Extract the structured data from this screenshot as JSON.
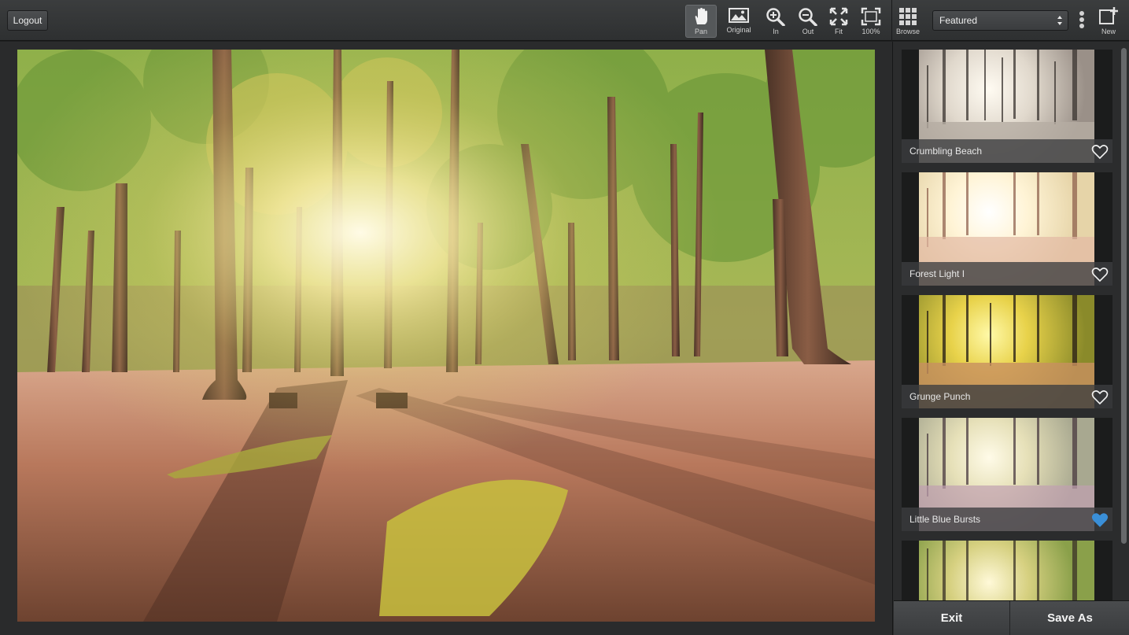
{
  "toolbar": {
    "logout_label": "Logout",
    "tools": [
      {
        "label": "Pan",
        "icon": "hand-icon",
        "active": true
      },
      {
        "label": "Original",
        "icon": "image-icon",
        "active": false
      },
      {
        "label": "In",
        "icon": "zoom-in-icon",
        "active": false
      },
      {
        "label": "Out",
        "icon": "zoom-out-icon",
        "active": false
      },
      {
        "label": "Fit",
        "icon": "fit-icon",
        "active": false
      },
      {
        "label": "100%",
        "icon": "actual-size-icon",
        "active": false
      }
    ],
    "browse_label": "Browse",
    "preset_select_value": "Featured",
    "new_label": "New"
  },
  "presets": [
    {
      "name": "Crumbling Beach",
      "favorite": false,
      "tone": "sepia"
    },
    {
      "name": "Forest Light I",
      "favorite": false,
      "tone": "bright"
    },
    {
      "name": "Grunge Punch",
      "favorite": false,
      "tone": "warm"
    },
    {
      "name": "Little Blue Bursts",
      "favorite": true,
      "tone": "cool"
    },
    {
      "name": "",
      "favorite": false,
      "tone": "natural"
    }
  ],
  "footer": {
    "exit_label": "Exit",
    "save_as_label": "Save As"
  },
  "colors": {
    "favorite_heart": "#3a8fd8",
    "toolbar_bg": "#2e3031"
  }
}
